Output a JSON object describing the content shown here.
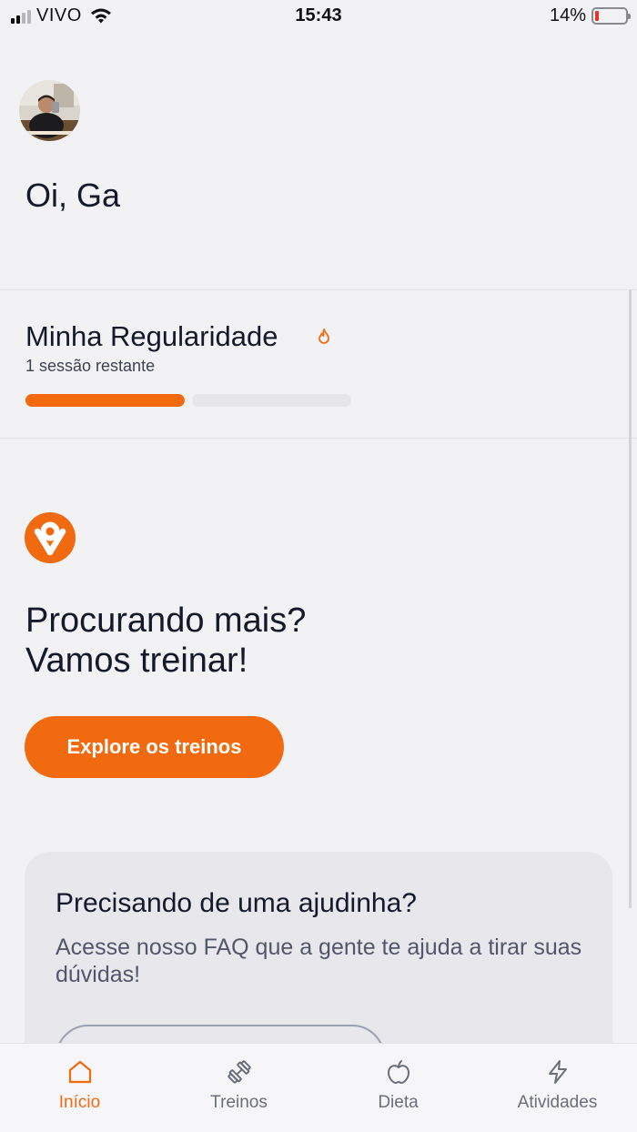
{
  "status_bar": {
    "carrier": "VIVO",
    "time": "15:43",
    "battery": "14%",
    "battery_level": 0.14
  },
  "header": {
    "greeting": "Oi, Ga"
  },
  "regularity": {
    "title": "Minha Regularidade",
    "subtitle": "1 sessão restante",
    "sessions_done": 1,
    "sessions_total": 2
  },
  "promo": {
    "title_line1": "Procurando mais?",
    "title_line2": "Vamos treinar!",
    "button_label": "Explore os treinos"
  },
  "help": {
    "title": "Precisando de uma ajudinha?",
    "text": "Acesse nosso FAQ que a gente te ajuda a tirar suas dúvidas!"
  },
  "tabs": [
    {
      "label": "Início",
      "icon": "home-icon",
      "active": true
    },
    {
      "label": "Treinos",
      "icon": "dumbbell-icon",
      "active": false
    },
    {
      "label": "Dieta",
      "icon": "apple-icon",
      "active": false
    },
    {
      "label": "Atividades",
      "icon": "lightning-icon",
      "active": false
    }
  ],
  "colors": {
    "accent": "#f26a0f",
    "text": "#14192b",
    "muted": "#6a6e7a"
  }
}
